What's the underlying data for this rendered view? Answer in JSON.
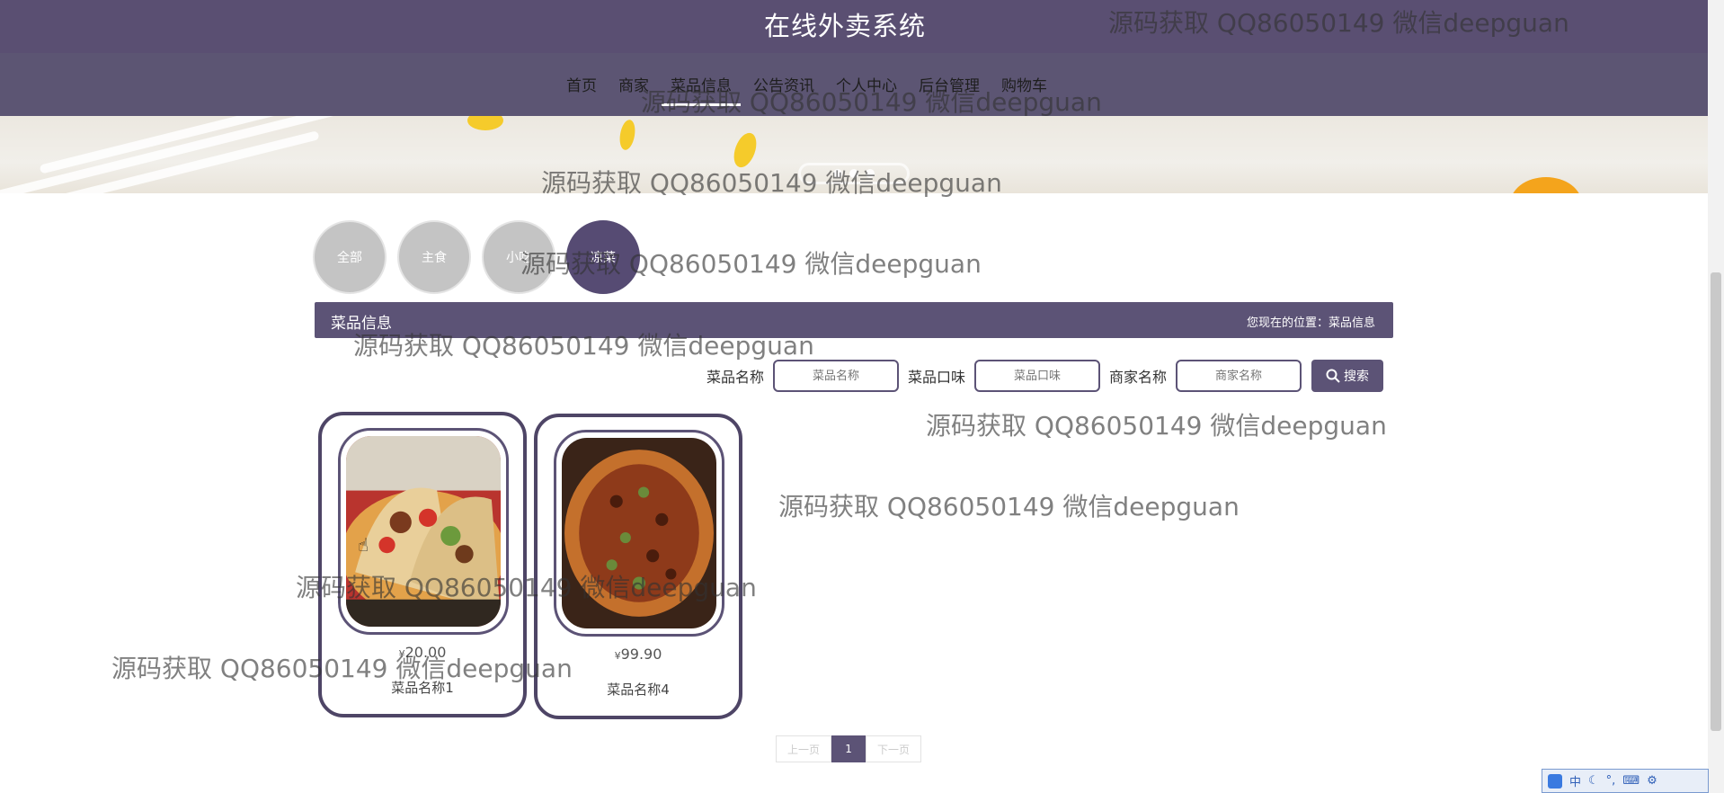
{
  "header": {
    "title": "在线外卖系统"
  },
  "nav": {
    "items": [
      {
        "label": "首页"
      },
      {
        "label": "商家"
      },
      {
        "label": "菜品信息"
      },
      {
        "label": "公告资讯"
      },
      {
        "label": "个人中心"
      },
      {
        "label": "后台管理"
      },
      {
        "label": "购物车"
      }
    ],
    "active": "菜品信息"
  },
  "categories": [
    {
      "label": "全部"
    },
    {
      "label": "主食"
    },
    {
      "label": "小吃"
    },
    {
      "label": "凉菜"
    }
  ],
  "infobar": {
    "title": "菜品信息",
    "location": "您现在的位置：菜品信息"
  },
  "search": {
    "fields": [
      {
        "label": "菜品名称",
        "placeholder": "菜品名称"
      },
      {
        "label": "菜品口味",
        "placeholder": "菜品口味"
      },
      {
        "label": "商家名称",
        "placeholder": "商家名称"
      }
    ],
    "button_label": "搜索"
  },
  "products": [
    {
      "currency": "¥",
      "price": "20.00",
      "name": "菜品名称1"
    },
    {
      "currency": "¥",
      "price": "99.90",
      "name": "菜品名称4"
    }
  ],
  "pagination": {
    "prev": "上一页",
    "current": "1",
    "next": "下一页"
  },
  "ime": {
    "lang": "中"
  },
  "watermark": "源码获取 QQ86050149 微信deepguan",
  "colors": {
    "primary": "#5c5376",
    "header": "#5a4f72"
  }
}
